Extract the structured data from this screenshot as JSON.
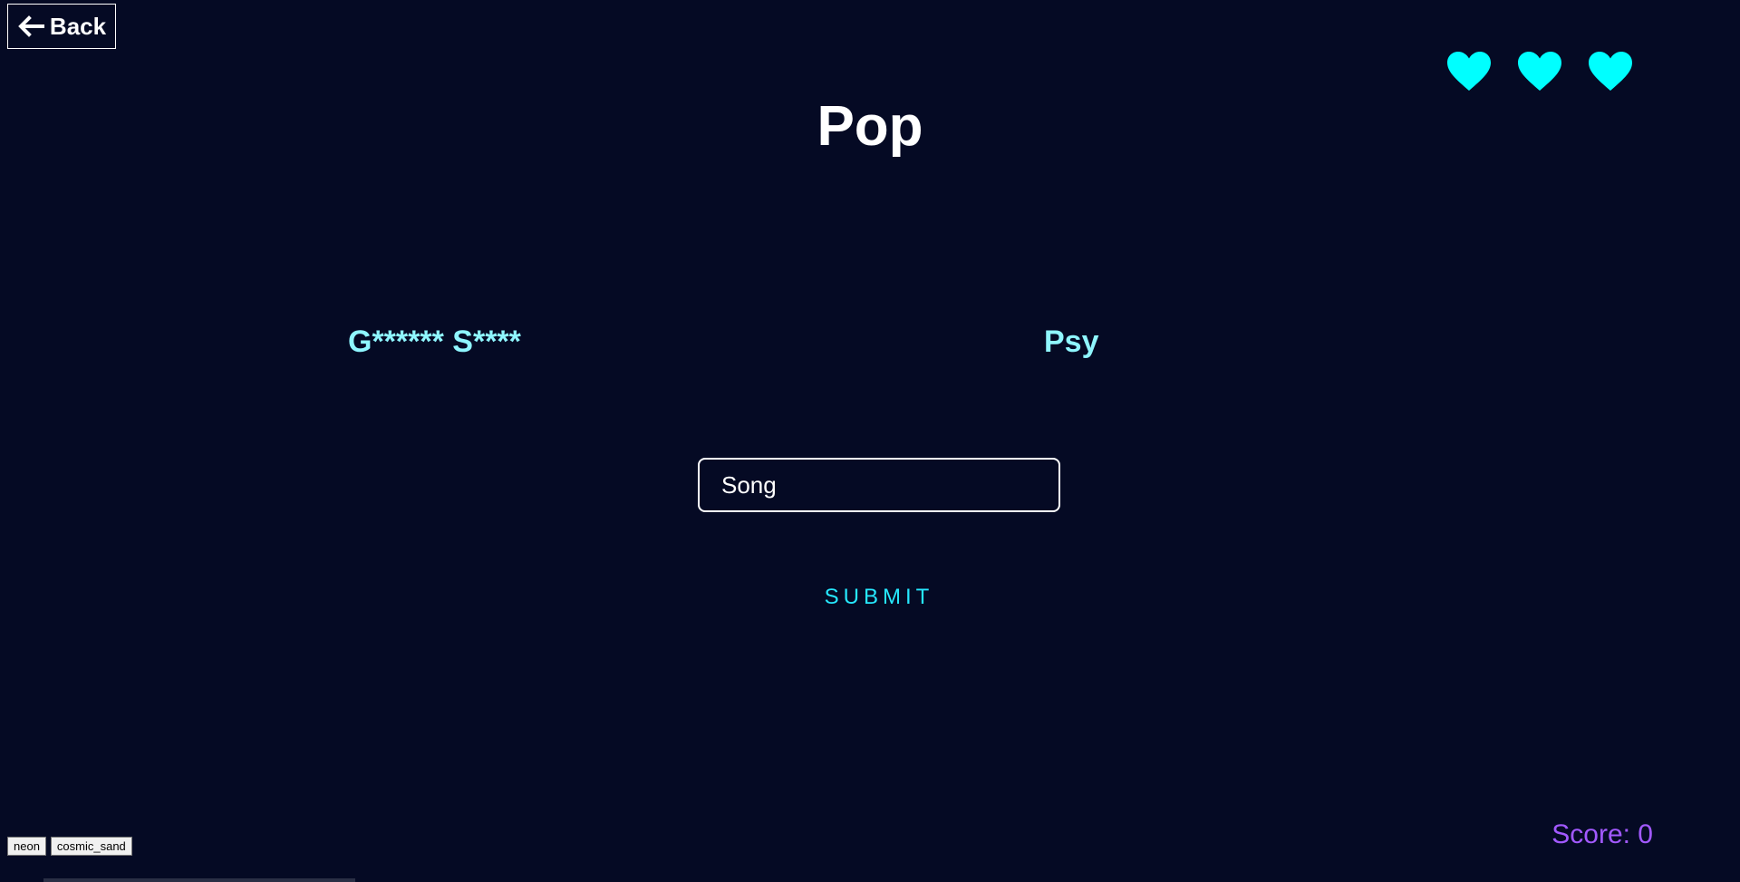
{
  "header": {
    "back_label": "Back"
  },
  "lives": {
    "remaining": 3,
    "total": 3,
    "heart_color": "#00ffff"
  },
  "game": {
    "category": "Pop",
    "song_hint": "G****** S****",
    "artist_hint": "Psy",
    "input_placeholder": "Song",
    "input_value": "",
    "submit_label": "SUBMIT"
  },
  "themes": {
    "options": [
      "neon",
      "cosmic_sand"
    ]
  },
  "score": {
    "text": "Score: 0",
    "value": 0
  },
  "colors": {
    "background": "#050a24",
    "hint": "#8ff6ff",
    "accent": "#26e8ff",
    "score": "#a259ff"
  }
}
